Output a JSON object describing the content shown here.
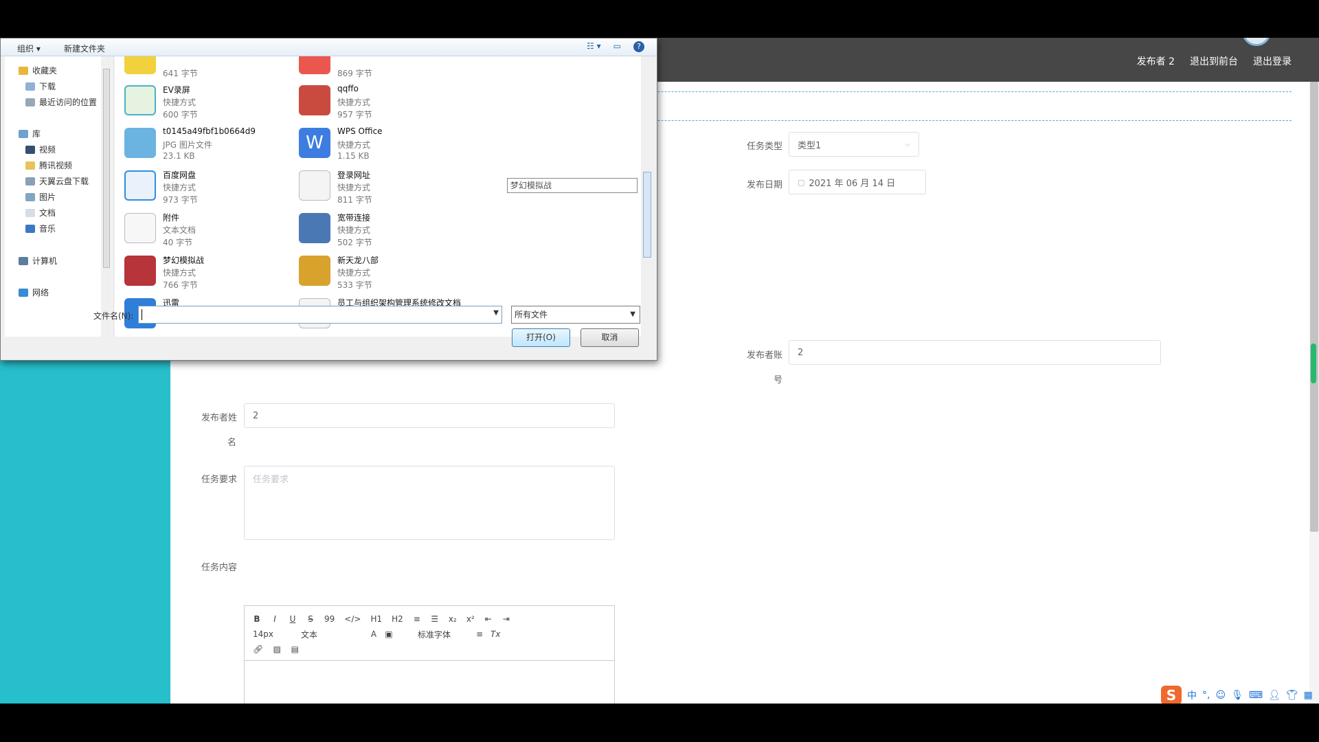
{
  "header": {
    "links": [
      "发布者 2",
      "退出到前台",
      "退出登录"
    ]
  },
  "form": {
    "task_type_label": "任务类型",
    "task_type_value": "类型1",
    "publish_date_label": "发布日期",
    "publish_date_value": "2021 年 06 月 14 日",
    "publisher_account_label_1": "发布者账",
    "publisher_account_label_2": "号",
    "publisher_account_value": "2",
    "publisher_name_label_1": "发布者姓",
    "publisher_name_label_2": "名",
    "publisher_name_value": "2",
    "task_req_label": "任务要求",
    "task_req_placeholder": "任务要求",
    "task_content_label": "任务内容"
  },
  "editor": {
    "row1": [
      "B",
      "I",
      "U",
      "S",
      "99",
      "</>",
      "H1",
      "H2",
      "≡",
      "☰",
      "x₂",
      "x²",
      "⇤",
      "⇥"
    ],
    "font_size": "14px",
    "text_style": "文本",
    "font_family": "标准字体",
    "clear": "Tx"
  },
  "ime": {
    "logo": "S",
    "lang": "中"
  },
  "dialog": {
    "toolbar": {
      "organize": "组织 ▾",
      "new_folder": "新建文件夹"
    },
    "nav": {
      "favorites": "收藏夹",
      "downloads": "下载",
      "recent": "最近访问的位置",
      "library": "库",
      "videos": "视频",
      "tencent_video": "腾讯视频",
      "tianyi": "天翼云盘下载",
      "pictures": "图片",
      "documents": "文档",
      "music": "音乐",
      "computer": "计算机",
      "network": "网络"
    },
    "files": [
      {
        "name": "",
        "type": "",
        "size": "641 字节"
      },
      {
        "name": "",
        "type": "",
        "size": "869 字节"
      },
      {
        "name": "EV录屏",
        "type": "快捷方式",
        "size": "600 字节"
      },
      {
        "name": "qqffo",
        "type": "快捷方式",
        "size": "957 字节"
      },
      {
        "name": "t0145a49fbf1b0664d9",
        "type": "JPG 图片文件",
        "size": "23.1 KB"
      },
      {
        "name": "WPS Office",
        "type": "快捷方式",
        "size": "1.15 KB"
      },
      {
        "name": "百度网盘",
        "type": "快捷方式",
        "size": "973 字节"
      },
      {
        "name": "登录网址",
        "type": "快捷方式",
        "size": "811 字节"
      },
      {
        "name": "附件",
        "type": "文本文档",
        "size": "40 字节"
      },
      {
        "name": "宽带连接",
        "type": "快捷方式",
        "size": "502 字节"
      },
      {
        "name": "梦幻模拟战",
        "type": "快捷方式",
        "size": "766 字节"
      },
      {
        "name": "新天龙八部",
        "type": "快捷方式",
        "size": "533 字节"
      },
      {
        "name": "迅雷",
        "type": "",
        "size": ""
      },
      {
        "name": "员工与组织架构管理系统修改文档",
        "type": "",
        "size": ""
      }
    ],
    "tooltip": "梦幻模拟战",
    "filename_label": "文件名(N):",
    "filename_value": "",
    "filter": "所有文件",
    "open_button": "打开(O)",
    "cancel_button": "取消"
  },
  "colors": {
    "sidebar": "#26bfcb",
    "header": "#474747"
  }
}
